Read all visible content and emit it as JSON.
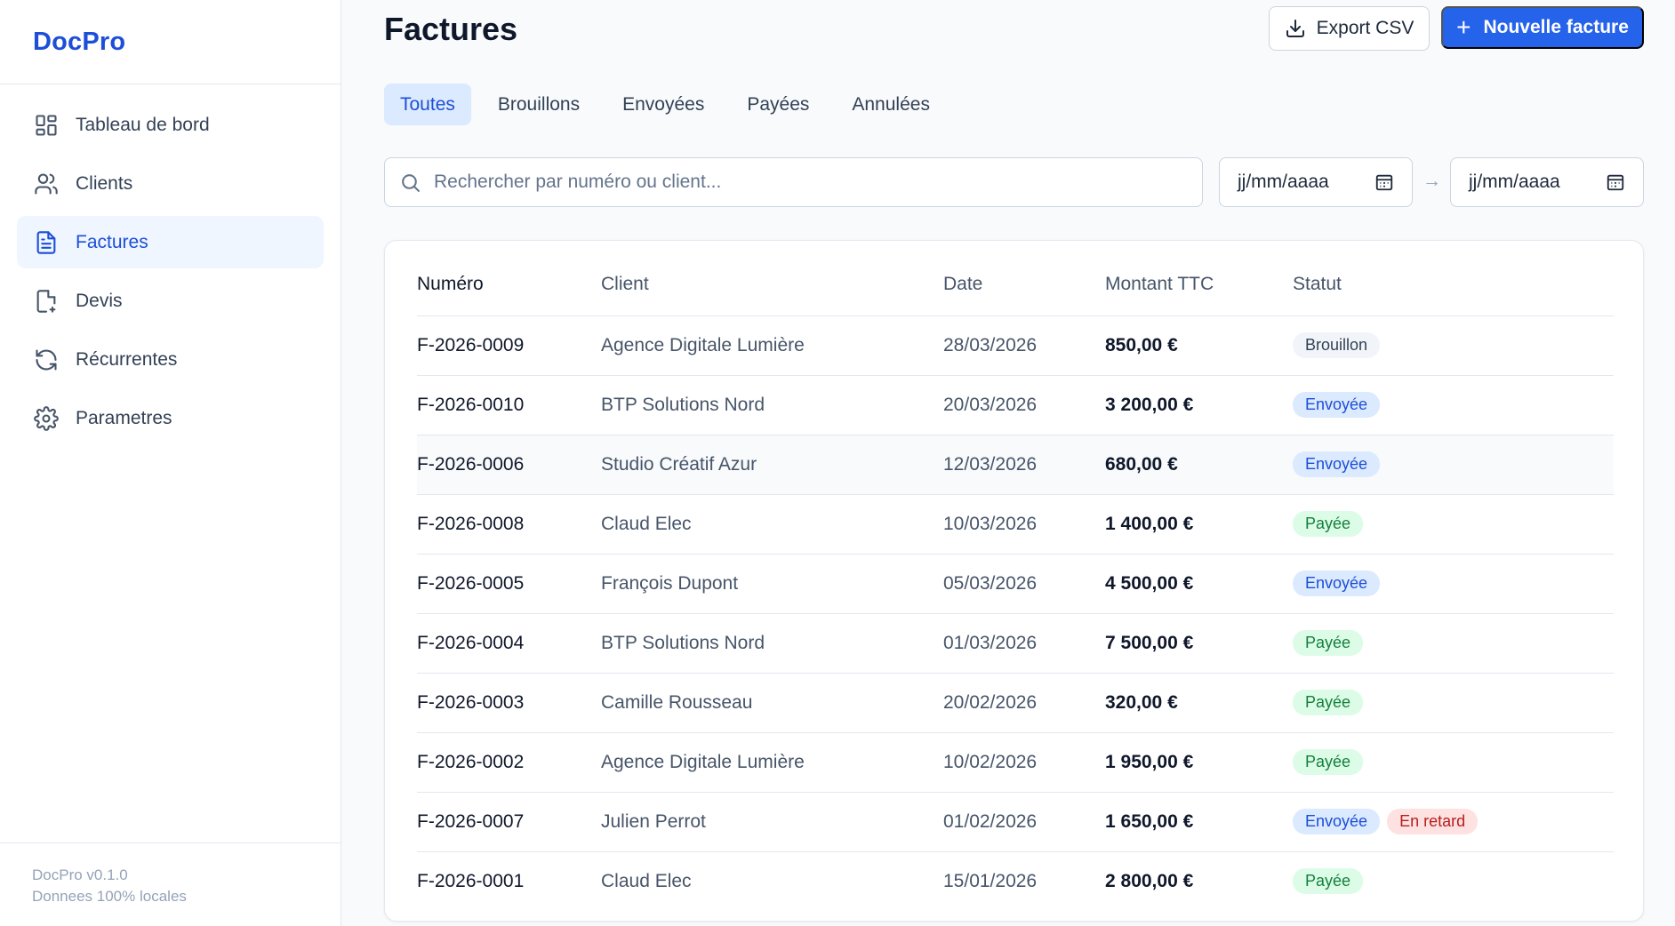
{
  "app": {
    "name": "DocPro"
  },
  "sidebar": {
    "items": [
      {
        "label": "Tableau de bord",
        "icon": "dashboard-icon",
        "active": false
      },
      {
        "label": "Clients",
        "icon": "users-icon",
        "active": false
      },
      {
        "label": "Factures",
        "icon": "invoice-icon",
        "active": true
      },
      {
        "label": "Devis",
        "icon": "quote-icon",
        "active": false
      },
      {
        "label": "Récurrentes",
        "icon": "refresh-icon",
        "active": false
      },
      {
        "label": "Parametres",
        "icon": "gear-icon",
        "active": false
      }
    ],
    "footer": {
      "version": "DocPro v0.1.0",
      "note": "Donnees 100% locales"
    }
  },
  "page": {
    "title": "Factures",
    "export_label": "Export CSV",
    "new_label": "Nouvelle facture"
  },
  "tabs": [
    {
      "label": "Toutes",
      "active": true
    },
    {
      "label": "Brouillons",
      "active": false
    },
    {
      "label": "Envoyées",
      "active": false
    },
    {
      "label": "Payées",
      "active": false
    },
    {
      "label": "Annulées",
      "active": false
    }
  ],
  "filters": {
    "search_placeholder": "Rechercher par numéro ou client...",
    "date_from": "jj/mm/aaaa",
    "date_to": "jj/mm/aaaa",
    "arrow": "→"
  },
  "table": {
    "headers": [
      "Numéro",
      "Client",
      "Date",
      "Montant TTC",
      "Statut"
    ],
    "rows": [
      {
        "num": "F-2026-0009",
        "client": "Agence Digitale Lumière",
        "date": "28/03/2026",
        "amount": "850,00 €",
        "statuses": [
          {
            "label": "Brouillon",
            "kind": "brouillon"
          }
        ]
      },
      {
        "num": "F-2026-0010",
        "client": "BTP Solutions Nord",
        "date": "20/03/2026",
        "amount": "3 200,00 €",
        "statuses": [
          {
            "label": "Envoyée",
            "kind": "envoyee"
          }
        ]
      },
      {
        "num": "F-2026-0006",
        "client": "Studio Créatif Azur",
        "date": "12/03/2026",
        "amount": "680,00 €",
        "statuses": [
          {
            "label": "Envoyée",
            "kind": "envoyee"
          }
        ],
        "hover": true
      },
      {
        "num": "F-2026-0008",
        "client": "Claud Elec",
        "date": "10/03/2026",
        "amount": "1 400,00 €",
        "statuses": [
          {
            "label": "Payée",
            "kind": "payee"
          }
        ]
      },
      {
        "num": "F-2026-0005",
        "client": "François Dupont",
        "date": "05/03/2026",
        "amount": "4 500,00 €",
        "statuses": [
          {
            "label": "Envoyée",
            "kind": "envoyee"
          }
        ]
      },
      {
        "num": "F-2026-0004",
        "client": "BTP Solutions Nord",
        "date": "01/03/2026",
        "amount": "7 500,00 €",
        "statuses": [
          {
            "label": "Payée",
            "kind": "payee"
          }
        ]
      },
      {
        "num": "F-2026-0003",
        "client": "Camille Rousseau",
        "date": "20/02/2026",
        "amount": "320,00 €",
        "statuses": [
          {
            "label": "Payée",
            "kind": "payee"
          }
        ]
      },
      {
        "num": "F-2026-0002",
        "client": "Agence Digitale Lumière",
        "date": "10/02/2026",
        "amount": "1 950,00 €",
        "statuses": [
          {
            "label": "Payée",
            "kind": "payee"
          }
        ]
      },
      {
        "num": "F-2026-0007",
        "client": "Julien Perrot",
        "date": "01/02/2026",
        "amount": "1 650,00 €",
        "statuses": [
          {
            "label": "Envoyée",
            "kind": "envoyee"
          },
          {
            "label": "En retard",
            "kind": "retard"
          }
        ]
      },
      {
        "num": "F-2026-0001",
        "client": "Claud Elec",
        "date": "15/01/2026",
        "amount": "2 800,00 €",
        "statuses": [
          {
            "label": "Payée",
            "kind": "payee"
          }
        ]
      }
    ]
  },
  "colors": {
    "accent": "#2563eb",
    "brand": "#1d4ed8"
  }
}
